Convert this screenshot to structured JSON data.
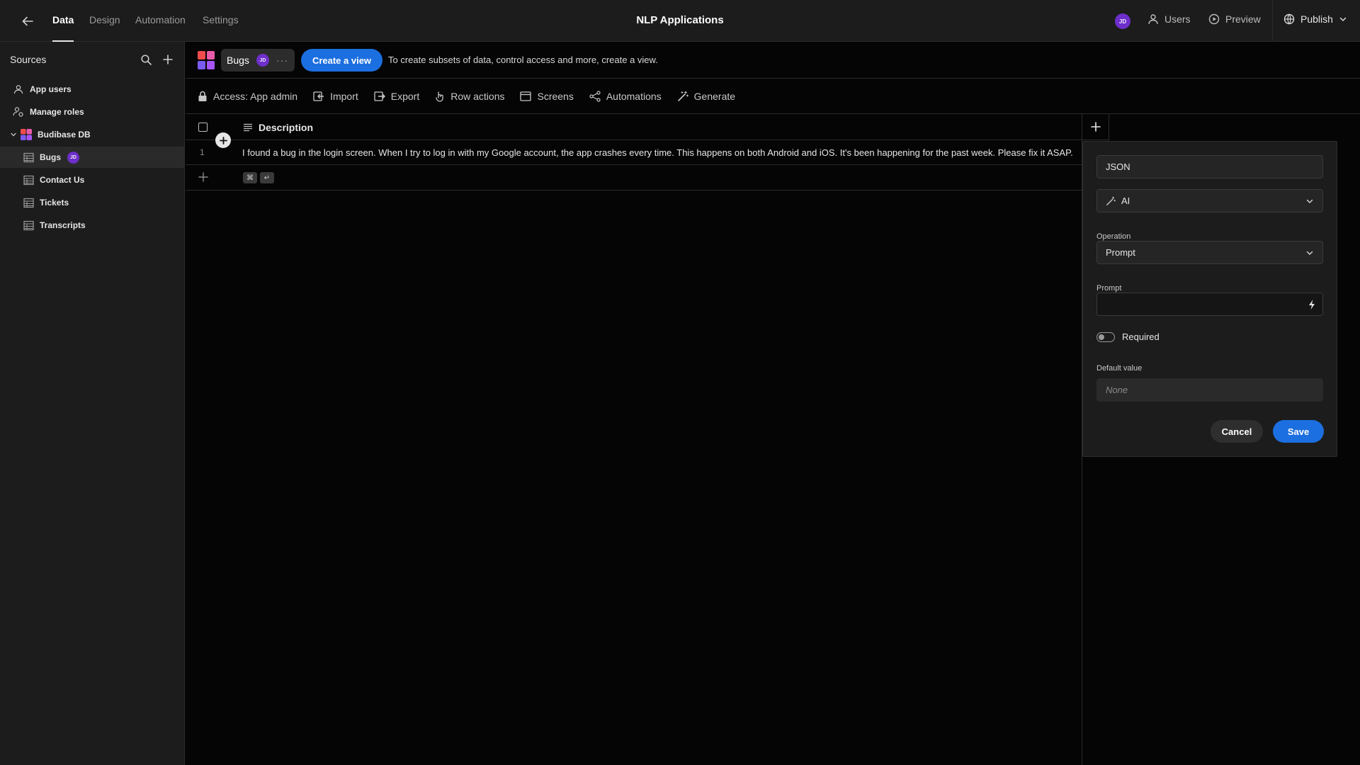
{
  "topbar": {
    "tabs": [
      {
        "label": "Data",
        "active": true
      },
      {
        "label": "Design"
      },
      {
        "label": "Automation"
      },
      {
        "label": "Settings"
      }
    ],
    "app_title": "NLP Applications",
    "user_initials": "JD",
    "users_label": "Users",
    "preview_label": "Preview",
    "publish_label": "Publish"
  },
  "sidebar": {
    "title": "Sources",
    "items": [
      {
        "label": "App users",
        "icon": "user-icon"
      },
      {
        "label": "Manage roles",
        "icon": "roles-icon"
      },
      {
        "label": "Budibase DB",
        "icon": "budibase-logo",
        "expanded": true
      },
      {
        "label": "Bugs",
        "icon": "table-icon",
        "selected": true,
        "badge": "JD"
      },
      {
        "label": "Contact Us",
        "icon": "table-icon"
      },
      {
        "label": "Tickets",
        "icon": "table-icon"
      },
      {
        "label": "Transcripts",
        "icon": "table-icon"
      }
    ]
  },
  "viewbar": {
    "table_name": "Bugs",
    "user_initials": "JD",
    "more_label": "···",
    "create_view_label": "Create a view",
    "hint": "To create subsets of data, control access and more, create a view."
  },
  "toolbar": {
    "items": [
      {
        "label": "Access: App admin",
        "icon": "lock-icon"
      },
      {
        "label": "Import",
        "icon": "import-icon"
      },
      {
        "label": "Export",
        "icon": "export-icon"
      },
      {
        "label": "Row actions",
        "icon": "row-actions-icon"
      },
      {
        "label": "Screens",
        "icon": "screens-icon"
      },
      {
        "label": "Automations",
        "icon": "automations-icon"
      },
      {
        "label": "Generate",
        "icon": "magic-wand-icon"
      }
    ]
  },
  "grid": {
    "column": "Description",
    "rows": [
      {
        "num": "1",
        "description": "I found a bug in the login screen. When I try to log in with my Google account, the app crashes every time. This happens on both Android and iOS. It's been happening for the past week. Please fix it ASAP."
      }
    ],
    "shortcut_keys": [
      "⌘",
      "↵"
    ]
  },
  "column_panel": {
    "name_value": "JSON",
    "type_value": "AI",
    "operation_label": "Operation",
    "operation_value": "Prompt",
    "prompt_label": "Prompt",
    "prompt_value": "",
    "required_label": "Required",
    "required": false,
    "default_label": "Default value",
    "default_placeholder": "None",
    "cancel_label": "Cancel",
    "save_label": "Save"
  },
  "colors": {
    "background": "#050505",
    "panel": "#1c1c1c",
    "accent_blue": "#1c6fe0",
    "avatar_purple": "#6d2fc9"
  }
}
